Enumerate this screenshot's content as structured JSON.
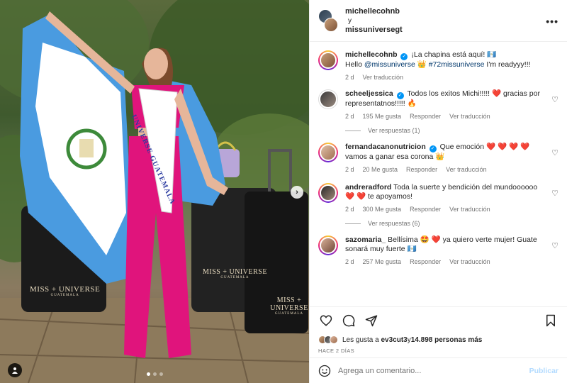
{
  "post": {
    "author": "michellecohnb",
    "connector": "y",
    "collaborator": "missuniversegt",
    "more_label": "•••"
  },
  "photo": {
    "sash_text": "UNIVERSE GUATEMALA",
    "bag_logo_1": "MISS + UNIVERSE",
    "bag_logo_1_sub": "GUATEMALA",
    "bag_logo_2": "MISS + UNIVERSE",
    "bag_logo_2_sub": "GUATEMALA",
    "bag_logo_3": "MISS + UNIVERSE",
    "bag_logo_3_sub": "GUATEMALA",
    "carousel_position": 1,
    "carousel_count": 3
  },
  "caption": {
    "user": "michellecohnb",
    "text_1": "¡La chapina está aquí! 🇬🇹",
    "text_2a": "Hello ",
    "mention": "@missuniverse",
    "text_2b": " 👑 ",
    "hashtag": "#72missuniverse",
    "text_2c": " I'm readyyy!!!",
    "time": "2 d",
    "translate": "Ver traducción"
  },
  "comments": [
    {
      "user": "scheeljessica",
      "verified": true,
      "text": "Todos los exitos Michi!!!!! ❤️ gracias por representatnos!!!!! 🔥",
      "time": "2 d",
      "likes": "195 Me gusta",
      "reply": "Responder",
      "translate": "Ver traducción",
      "replies": "Ver respuestas (1)"
    },
    {
      "user": "fernandacanonutricion",
      "verified": true,
      "text": "Que emoción ❤️ ❤️ ❤️ ❤️ vamos a ganar esa corona 👑",
      "time": "2 d",
      "likes": "20 Me gusta",
      "reply": "Responder",
      "translate": "Ver traducción"
    },
    {
      "user": "andreradford",
      "verified": false,
      "text": "Toda la suerte y bendición del mundoooooo ❤️ ❤️ te apoyamos!",
      "time": "2 d",
      "likes": "300 Me gusta",
      "reply": "Responder",
      "translate": "Ver traducción",
      "replies": "Ver respuestas (6)"
    },
    {
      "user": "sazomaria_",
      "verified": false,
      "text": "Bellísima 🤩 ❤️ ya quiero verte mujer! Guate sonará muy fuerte 🇬🇹",
      "time": "2 d",
      "likes": "257 Me gusta",
      "reply": "Responder",
      "translate": "Ver traducción"
    }
  ],
  "likes": {
    "prefix": "Les gusta a ",
    "user": "ev3cut3",
    "mid": " y ",
    "count": "14.898 personas más"
  },
  "time_ago": "HACE 2 DÍAS",
  "composer": {
    "placeholder": "Agrega un comentario...",
    "publish": "Publicar"
  },
  "colors": {
    "flag_blue": "#4a9be0",
    "dress_pink": "#e0147c",
    "accent_link": "#00376b",
    "publish_disabled": "#b3dbff"
  }
}
